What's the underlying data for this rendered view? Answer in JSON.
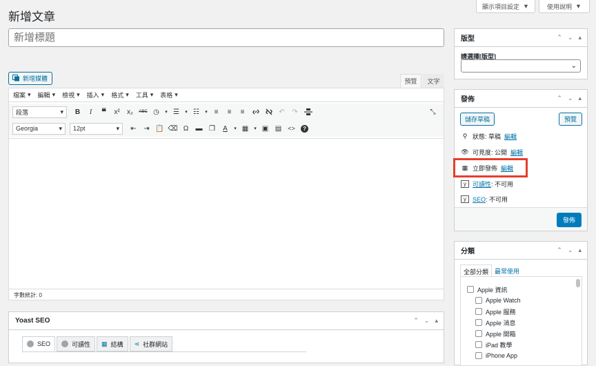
{
  "page": {
    "title": "新增文章"
  },
  "screen_options": {
    "label": "顯示項目設定",
    "help_label": "使用說明"
  },
  "title_field": {
    "placeholder": "新增標題"
  },
  "editor": {
    "add_media": "新增媒體",
    "tab_visual": "預覽",
    "tab_text": "文字",
    "menu": [
      "檔案",
      "編輯",
      "檢視",
      "插入",
      "格式",
      "工具",
      "表格"
    ],
    "format_select": "段落",
    "font_select": "Georgia",
    "size_select": "12pt",
    "word_count": "字數統計: 0"
  },
  "format_box": {
    "title": "版型",
    "label": "請選擇[版型]",
    "select_value": ""
  },
  "publish_box": {
    "title": "發佈",
    "save_draft": "儲存草稿",
    "preview": "預覽",
    "status_label": "狀態: 草稿",
    "visibility_label": "可見度: 公開",
    "schedule_label": "立即發佈",
    "edit": "編輯",
    "readability_link": "可讀性",
    "readability_value": ": 不可用",
    "seo_link": "SEO",
    "seo_value": ": 不可用",
    "publish": "發佈",
    "highlight_color": "#e53e2d"
  },
  "categories_box": {
    "title": "分類",
    "tab_all": "全部分類",
    "tab_popular": "最常使用",
    "items": [
      {
        "label": "Apple 資訊",
        "level": 0
      },
      {
        "label": "Apple Watch",
        "level": 1
      },
      {
        "label": "Apple 服務",
        "level": 1
      },
      {
        "label": "Apple 消息",
        "level": 1
      },
      {
        "label": "Apple 開箱",
        "level": 1
      },
      {
        "label": "iPad 教學",
        "level": 1
      },
      {
        "label": "iPhone App",
        "level": 1
      }
    ]
  },
  "yoast_box": {
    "title": "Yoast SEO",
    "tabs": [
      "SEO",
      "可讀性",
      "結構",
      "社群網站"
    ]
  },
  "colors": {
    "accent": "#0073aa",
    "primary_button": "#007cba"
  }
}
